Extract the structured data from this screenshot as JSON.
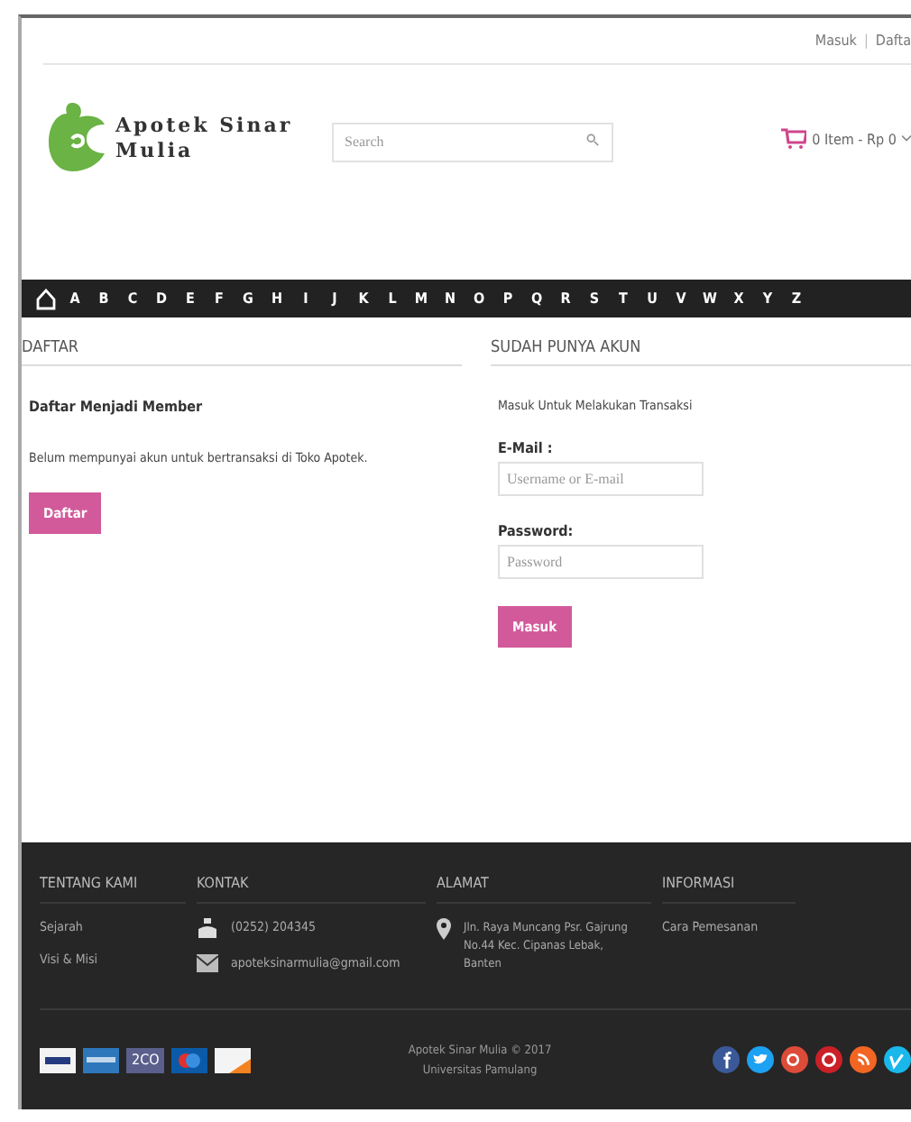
{
  "top_links": [
    "Masuk",
    "|",
    "Dafta"
  ],
  "logo": {
    "line1": "Apotek Sinar",
    "line2": "Mulia"
  },
  "search": {
    "placeholder": "Search"
  },
  "cart": {
    "text": "0 Item - Rp 0"
  },
  "alphabet": [
    "A",
    "B",
    "C",
    "D",
    "E",
    "F",
    "G",
    "H",
    "I",
    "J",
    "K",
    "L",
    "M",
    "N",
    "O",
    "P",
    "Q",
    "R",
    "S",
    "T",
    "U",
    "V",
    "W",
    "X",
    "Y",
    "Z"
  ],
  "register": {
    "heading": "DAFTAR",
    "title": "Daftar Menjadi Member",
    "text": "Belum mempunyai akun untuk bertransaksi di Toko Apotek.",
    "button": "Daftar"
  },
  "login": {
    "heading": "SUDAH PUNYA AKUN",
    "intro": "Masuk Untuk Melakukan Transaksi",
    "email_label": "E-Mail :",
    "email": {
      "placeholder": "Username or E-mail"
    },
    "password_label": "Password:",
    "password": {
      "placeholder": "Password"
    },
    "button": "Masuk"
  },
  "footer": {
    "columns": [
      {
        "heading": "TENTANG KAMI",
        "items": [
          {
            "kind": "link",
            "text": "Sejarah"
          },
          {
            "kind": "link",
            "text": "Visi & Misi"
          }
        ]
      },
      {
        "heading": "KONTAK",
        "items": [
          {
            "kind": "phone",
            "text": "(0252) 204345"
          },
          {
            "kind": "mail",
            "text": "apoteksinarmulia@gmail.com"
          }
        ]
      },
      {
        "heading": "ALAMAT",
        "items": [
          {
            "kind": "address",
            "text": "Jln. Raya Muncang Psr. Gajrung No.44 Kec. Cipanas Lebak, Banten"
          }
        ]
      },
      {
        "heading": "INFORMASI",
        "items": [
          {
            "kind": "link",
            "text": "Cara Pemesanan"
          }
        ]
      }
    ],
    "payments": [
      {
        "kind": "paypal"
      },
      {
        "kind": "amex"
      },
      {
        "kind": "text",
        "text": "2CO"
      },
      {
        "kind": "maestro"
      },
      {
        "kind": "discover"
      }
    ],
    "copyright": [
      "Apotek Sinar Mulia © 2017",
      "Universitas Pamulang"
    ],
    "social": [
      {
        "kind": "facebook",
        "color": "#3b5998"
      },
      {
        "kind": "twitter",
        "color": "#1da1f2"
      },
      {
        "kind": "googleplus",
        "color": "#dd4b39"
      },
      {
        "kind": "pinterest",
        "color": "#cb2027"
      },
      {
        "kind": "rss",
        "color": "#f26522"
      },
      {
        "kind": "vimeo",
        "color": "#1ab7ea"
      }
    ]
  }
}
